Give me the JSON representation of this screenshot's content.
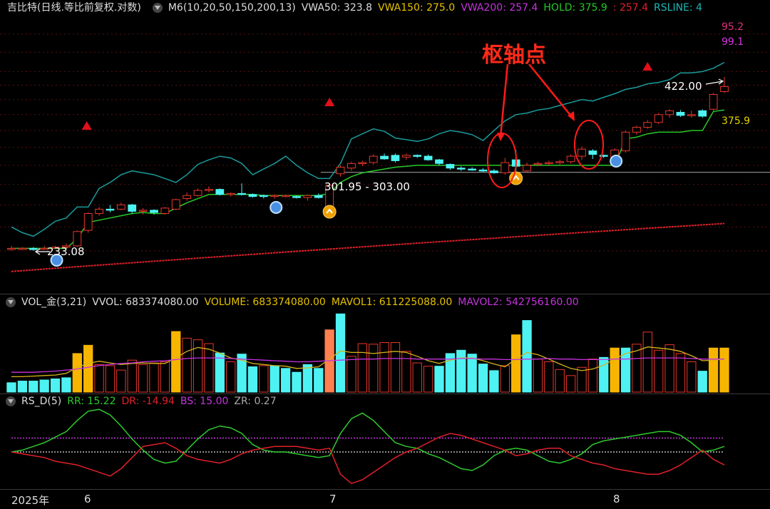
{
  "header": {
    "stock": "吉比特(日线.等比前复权.对数)",
    "ma_name": "M6(10,20,50,150,200,13)",
    "vwa50": "VWA50: 323.8",
    "vwa150": "VWA150: 275.0",
    "vwa200": "VWA200: 257.4",
    "hold": "HOLD: 375.9",
    "sep": ": 257.4",
    "rsline": "RSLINE: 4"
  },
  "price_panel": {
    "label_95": "95.2",
    "label_99": "99.1",
    "label_422": "422.00",
    "label_375": "375.9",
    "label_range": "301.95 - 303.00",
    "label_233": "233.08",
    "annotation": "枢轴点"
  },
  "vol_header": {
    "name": "VOL_金(3,21)",
    "vvol": "VVOL: 683374080.00",
    "volume": "VOLUME: 683374080.00",
    "mavol1": "MAVOL1: 611225088.00",
    "mavol2": "MAVOL2: 542756160.00"
  },
  "rs_header": {
    "name": "RS_D(5)",
    "rr": "RR: 15.22",
    "dr": "DR: -14.94",
    "bs": "BS: 15.00",
    "zr": "ZR: 0.27"
  },
  "xaxis": {
    "year": "2025年",
    "m6": "6",
    "m7": "7",
    "m8": "8"
  },
  "colors": {
    "up": "#e8372b",
    "down": "#4ef2f2",
    "vol_gold": "#f7b500",
    "vol_orange": "#ff7f50",
    "hold": "#27c927",
    "rsline": "#1a9b9b",
    "vwa200": "#e0202a",
    "mavol1": "#d6b31a",
    "mavol2": "#c733e0",
    "rr": "#2ec92e",
    "dr": "#e0202a"
  },
  "chart_data": [
    {
      "type": "candlestick",
      "title": "吉比特(日线.等比前复权.对数)",
      "candles": [
        {
          "o": 232,
          "h": 234,
          "l": 230,
          "c": 232
        },
        {
          "o": 232,
          "h": 233,
          "l": 231,
          "c": 232
        },
        {
          "o": 232,
          "h": 233,
          "l": 230,
          "c": 231
        },
        {
          "o": 232,
          "h": 234,
          "l": 231,
          "c": 232
        },
        {
          "o": 233,
          "h": 234,
          "l": 232,
          "c": 233
        },
        {
          "o": 233,
          "h": 236,
          "l": 231,
          "c": 234
        },
        {
          "o": 234,
          "h": 247,
          "l": 233,
          "c": 246
        },
        {
          "o": 247,
          "h": 263,
          "l": 245,
          "c": 262
        },
        {
          "o": 262,
          "h": 268,
          "l": 260,
          "c": 266
        },
        {
          "o": 266,
          "h": 270,
          "l": 263,
          "c": 265
        },
        {
          "o": 266,
          "h": 272,
          "l": 265,
          "c": 270
        },
        {
          "o": 270,
          "h": 271,
          "l": 262,
          "c": 264
        },
        {
          "o": 264,
          "h": 267,
          "l": 261,
          "c": 265
        },
        {
          "o": 265,
          "h": 266,
          "l": 261,
          "c": 263
        },
        {
          "o": 262,
          "h": 268,
          "l": 261,
          "c": 267
        },
        {
          "o": 266,
          "h": 276,
          "l": 265,
          "c": 275
        },
        {
          "o": 276,
          "h": 282,
          "l": 274,
          "c": 279
        },
        {
          "o": 279,
          "h": 286,
          "l": 278,
          "c": 284
        },
        {
          "o": 284,
          "h": 288,
          "l": 282,
          "c": 285
        },
        {
          "o": 285,
          "h": 286,
          "l": 279,
          "c": 280
        },
        {
          "o": 280,
          "h": 282,
          "l": 278,
          "c": 281
        },
        {
          "o": 281,
          "h": 291,
          "l": 279,
          "c": 280
        },
        {
          "o": 280,
          "h": 281,
          "l": 277,
          "c": 278
        },
        {
          "o": 279,
          "h": 280,
          "l": 276,
          "c": 278
        },
        {
          "o": 278,
          "h": 280,
          "l": 276,
          "c": 279
        },
        {
          "o": 278,
          "h": 280,
          "l": 277,
          "c": 279
        },
        {
          "o": 278,
          "h": 279,
          "l": 276,
          "c": 277
        },
        {
          "o": 277,
          "h": 280,
          "l": 274,
          "c": 279
        },
        {
          "o": 279,
          "h": 281,
          "l": 276,
          "c": 277
        },
        {
          "o": 268,
          "h": 291,
          "l": 266,
          "c": 289
        },
        {
          "o": 301,
          "h": 310,
          "l": 298,
          "c": 308
        },
        {
          "o": 307,
          "h": 314,
          "l": 304,
          "c": 312
        },
        {
          "o": 312,
          "h": 315,
          "l": 309,
          "c": 313
        },
        {
          "o": 313,
          "h": 322,
          "l": 311,
          "c": 320
        },
        {
          "o": 320,
          "h": 323,
          "l": 316,
          "c": 317
        },
        {
          "o": 321,
          "h": 323,
          "l": 313,
          "c": 315
        },
        {
          "o": 319,
          "h": 323,
          "l": 316,
          "c": 321
        },
        {
          "o": 321,
          "h": 322,
          "l": 318,
          "c": 320
        },
        {
          "o": 320,
          "h": 322,
          "l": 315,
          "c": 316
        },
        {
          "o": 316,
          "h": 317,
          "l": 310,
          "c": 312
        },
        {
          "o": 311,
          "h": 312,
          "l": 305,
          "c": 307
        },
        {
          "o": 307,
          "h": 309,
          "l": 304,
          "c": 306
        },
        {
          "o": 306,
          "h": 308,
          "l": 304,
          "c": 305
        },
        {
          "o": 305,
          "h": 307,
          "l": 303,
          "c": 304
        },
        {
          "o": 304,
          "h": 306,
          "l": 301,
          "c": 302
        },
        {
          "o": 302,
          "h": 318,
          "l": 300,
          "c": 313
        },
        {
          "o": 316,
          "h": 327,
          "l": 304,
          "c": 309
        },
        {
          "o": 304,
          "h": 313,
          "l": 303,
          "c": 310
        },
        {
          "o": 311,
          "h": 314,
          "l": 309,
          "c": 312
        },
        {
          "o": 312,
          "h": 315,
          "l": 310,
          "c": 313
        },
        {
          "o": 313,
          "h": 316,
          "l": 311,
          "c": 314
        },
        {
          "o": 314,
          "h": 322,
          "l": 312,
          "c": 320
        },
        {
          "o": 320,
          "h": 331,
          "l": 316,
          "c": 328
        },
        {
          "o": 326,
          "h": 328,
          "l": 317,
          "c": 322
        },
        {
          "o": 321,
          "h": 322,
          "l": 318,
          "c": 320
        },
        {
          "o": 319,
          "h": 329,
          "l": 317,
          "c": 327
        },
        {
          "o": 326,
          "h": 350,
          "l": 324,
          "c": 348
        },
        {
          "o": 348,
          "h": 356,
          "l": 345,
          "c": 354
        },
        {
          "o": 354,
          "h": 363,
          "l": 352,
          "c": 360
        },
        {
          "o": 360,
          "h": 372,
          "l": 358,
          "c": 370
        },
        {
          "o": 370,
          "h": 377,
          "l": 366,
          "c": 375
        },
        {
          "o": 373,
          "h": 376,
          "l": 367,
          "c": 369
        },
        {
          "o": 369,
          "h": 375,
          "l": 366,
          "c": 370
        },
        {
          "o": 375,
          "h": 377,
          "l": 366,
          "c": 368
        },
        {
          "o": 377,
          "h": 399,
          "l": 375,
          "c": 397
        },
        {
          "o": 401,
          "h": 422,
          "l": 399,
          "c": 408
        }
      ],
      "rsline": [
        250,
        245,
        242,
        248,
        255,
        258,
        268,
        268,
        286,
        292,
        300,
        304,
        302,
        300,
        296,
        292,
        300,
        311,
        316,
        320,
        318,
        312,
        300,
        306,
        312,
        320,
        310,
        302,
        296,
        296,
        312,
        340,
        346,
        352,
        349,
        341,
        339,
        337,
        340,
        346,
        350,
        348,
        345,
        338,
        350,
        362,
        370,
        372,
        376,
        378,
        382,
        386,
        390,
        388,
        393,
        398,
        404,
        407,
        412,
        414,
        418,
        428,
        428,
        430,
        435,
        444
      ],
      "hold": [
        232,
        232,
        232,
        232,
        232,
        232,
        240,
        254,
        256,
        258,
        260,
        262,
        263,
        262,
        262,
        267,
        272,
        276,
        280,
        280,
        280,
        280,
        280,
        279,
        279,
        279,
        279,
        279,
        279,
        281,
        292,
        298,
        302,
        304,
        306,
        308,
        309,
        310,
        310,
        310,
        310,
        310,
        310,
        310,
        310,
        310,
        310,
        310,
        310,
        310,
        310,
        310,
        310,
        310,
        310,
        310,
        340,
        342,
        346,
        348,
        348,
        348,
        350,
        350,
        374,
        376
      ],
      "vwa200": [
        ",;"
      ],
      "labels": [
        "95.2",
        "99.1",
        "422.00",
        "375.9",
        "301.95 - 303.00",
        "233.08"
      ],
      "annotation": "枢轴点"
    },
    {
      "type": "bar",
      "title": "VOL_金(3,21)",
      "volume": [
        0.17,
        0.2,
        0.2,
        0.22,
        0.24,
        0.26,
        0.7,
        0.85,
        0.5,
        0.48,
        0.4,
        0.58,
        0.5,
        0.53,
        0.55,
        1.1,
        0.98,
        0.95,
        0.88,
        0.71,
        0.55,
        0.69,
        0.46,
        0.48,
        0.48,
        0.43,
        0.36,
        0.5,
        0.43,
        1.13,
        1.42,
        0.65,
        0.88,
        0.87,
        0.9,
        0.9,
        0.74,
        0.53,
        0.47,
        0.47,
        0.7,
        0.76,
        0.69,
        0.51,
        0.39,
        0.48,
        1.04,
        1.3,
        0.6,
        0.55,
        0.41,
        0.3,
        0.45,
        0.6,
        0.63,
        0.8,
        0.8,
        0.87,
        1.09,
        0.76,
        0.86,
        0.7,
        0.55,
        0.38,
        0.8,
        0.8
      ],
      "kinds": [
        "d",
        "d",
        "d",
        "d",
        "d",
        "d",
        "g",
        "g",
        "u",
        "u",
        "u",
        "u",
        "u",
        "u",
        "u",
        "g",
        "u",
        "u",
        "u",
        "d",
        "u",
        "d",
        "d",
        "u",
        "d",
        "d",
        "d",
        "d",
        "d",
        "o",
        "d",
        "u",
        "u",
        "u",
        "u",
        "u",
        "u",
        "u",
        "u",
        "d",
        "d",
        "d",
        "d",
        "d",
        "d",
        "u",
        "g",
        "d",
        "u",
        "u",
        "u",
        "u",
        "u",
        "u",
        "d",
        "g",
        "d",
        "u",
        "u",
        "u",
        "u",
        "u",
        "u",
        "d",
        "g",
        "g"
      ],
      "mavol1": [
        0.28,
        0.28,
        0.29,
        0.3,
        0.31,
        0.34,
        0.45,
        0.52,
        0.56,
        0.53,
        0.5,
        0.52,
        0.53,
        0.52,
        0.52,
        0.62,
        0.74,
        0.81,
        0.78,
        0.71,
        0.62,
        0.58,
        0.52,
        0.5,
        0.48,
        0.47,
        0.43,
        0.44,
        0.46,
        0.6,
        0.75,
        0.72,
        0.72,
        0.7,
        0.72,
        0.74,
        0.72,
        0.65,
        0.57,
        0.52,
        0.58,
        0.62,
        0.62,
        0.57,
        0.51,
        0.46,
        0.6,
        0.72,
        0.68,
        0.6,
        0.51,
        0.43,
        0.39,
        0.42,
        0.49,
        0.6,
        0.7,
        0.75,
        0.82,
        0.8,
        0.78,
        0.74,
        0.66,
        0.57,
        0.58,
        0.6
      ],
      "mavol2": [
        0.36,
        0.36,
        0.36,
        0.37,
        0.38,
        0.4,
        0.42,
        0.45,
        0.48,
        0.5,
        0.52,
        0.53,
        0.55,
        0.56,
        0.57,
        0.59,
        0.61,
        0.62,
        0.62,
        0.62,
        0.61,
        0.6,
        0.59,
        0.58,
        0.57,
        0.56,
        0.55,
        0.55,
        0.56,
        0.57,
        0.58,
        0.59,
        0.6,
        0.6,
        0.61,
        0.61,
        0.61,
        0.6,
        0.6,
        0.6,
        0.6,
        0.61,
        0.61,
        0.6,
        0.6,
        0.59,
        0.59,
        0.6,
        0.6,
        0.61,
        0.6,
        0.6,
        0.59,
        0.59,
        0.59,
        0.6,
        0.6,
        0.61,
        0.62,
        0.62,
        0.62,
        0.62,
        0.61,
        0.6,
        0.6,
        0.6
      ]
    },
    {
      "type": "line",
      "title": "RS_D(5)",
      "rr": [
        0,
        2,
        6,
        10,
        16,
        22,
        34,
        44,
        46,
        40,
        28,
        14,
        2,
        -8,
        -12,
        -10,
        2,
        14,
        24,
        28,
        26,
        20,
        8,
        2,
        0,
        0,
        -2,
        -4,
        -6,
        -4,
        20,
        36,
        42,
        34,
        22,
        10,
        6,
        4,
        -2,
        -6,
        -12,
        -18,
        -20,
        -14,
        -4,
        2,
        4,
        2,
        -4,
        -10,
        -12,
        -8,
        -2,
        8,
        12,
        14,
        16,
        18,
        20,
        22,
        22,
        18,
        10,
        0,
        2,
        6
      ],
      "dr": [
        0,
        -2,
        -4,
        -6,
        -10,
        -12,
        -14,
        -18,
        -22,
        -26,
        -18,
        -6,
        6,
        8,
        10,
        4,
        -4,
        -8,
        -10,
        -12,
        -8,
        -2,
        2,
        4,
        6,
        6,
        6,
        4,
        2,
        4,
        -24,
        -34,
        -30,
        -22,
        -14,
        -6,
        0,
        4,
        10,
        16,
        20,
        18,
        14,
        10,
        6,
        2,
        -4,
        -2,
        2,
        4,
        4,
        -4,
        -8,
        -12,
        -14,
        -18,
        -20,
        -22,
        -24,
        -24,
        -20,
        -14,
        -6,
        2,
        -8,
        -14
      ],
      "bs": 15,
      "zr_level": 0
    }
  ]
}
